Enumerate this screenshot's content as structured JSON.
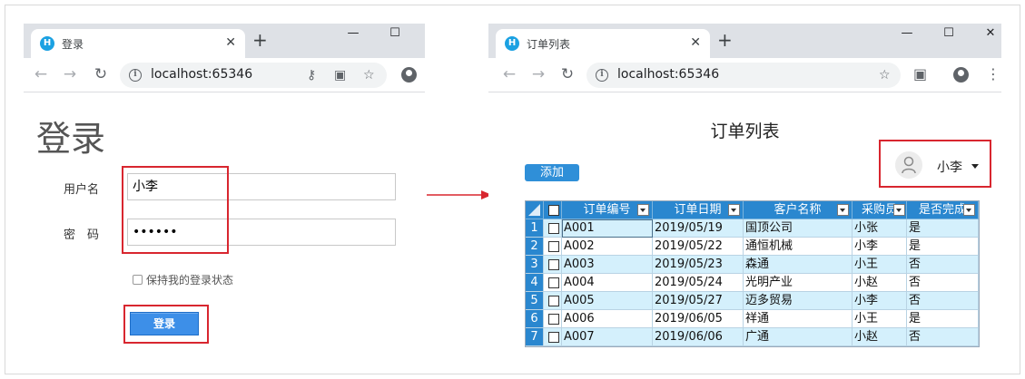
{
  "login_window": {
    "tab_title": "登录",
    "tab_favicon": "H",
    "url": "localhost:65346",
    "page_title": "登录",
    "username_label": "用户名",
    "username_value": "小李",
    "password_label": "密　码",
    "password_value": "••••••",
    "remember_label": "保持我的登录状态",
    "login_button": "登录"
  },
  "orders_window": {
    "tab_title": "订单列表",
    "tab_favicon": "H",
    "url": "localhost:65346",
    "page_title": "订单列表",
    "user_name": "小李",
    "add_button": "添加",
    "columns": [
      "订单编号",
      "订单日期",
      "客户名称",
      "采购员",
      "是否完成"
    ],
    "rows": [
      {
        "num": "1",
        "id": "A001",
        "date": "2019/05/19",
        "customer": "国顶公司",
        "buyer": "小张",
        "done": "是"
      },
      {
        "num": "2",
        "id": "A002",
        "date": "2019/05/22",
        "customer": "通恒机械",
        "buyer": "小李",
        "done": "是"
      },
      {
        "num": "3",
        "id": "A003",
        "date": "2019/05/23",
        "customer": "森通",
        "buyer": "小王",
        "done": "否"
      },
      {
        "num": "4",
        "id": "A004",
        "date": "2019/05/24",
        "customer": "光明产业",
        "buyer": "小赵",
        "done": "否"
      },
      {
        "num": "5",
        "id": "A005",
        "date": "2019/05/27",
        "customer": "迈多贸易",
        "buyer": "小李",
        "done": "否"
      },
      {
        "num": "6",
        "id": "A006",
        "date": "2019/06/05",
        "customer": "祥通",
        "buyer": "小王",
        "done": "是"
      },
      {
        "num": "7",
        "id": "A007",
        "date": "2019/06/06",
        "customer": "广通",
        "buyer": "小赵",
        "done": "否"
      }
    ]
  },
  "colors": {
    "highlight_red": "#d8262f",
    "grid_header": "#2a87cf",
    "grid_alt_row": "#d4f0fc",
    "button_blue": "#3d8fe8"
  },
  "icons": [
    "back-arrow-icon",
    "forward-arrow-icon",
    "reload-icon",
    "info-icon",
    "key-icon",
    "translate-icon",
    "star-icon",
    "account-icon",
    "close-icon",
    "new-tab-icon",
    "minimize-icon",
    "maximize-icon",
    "window-close-icon",
    "menu-icon",
    "user-avatar-icon",
    "filter-icon",
    "checkbox-icon"
  ]
}
